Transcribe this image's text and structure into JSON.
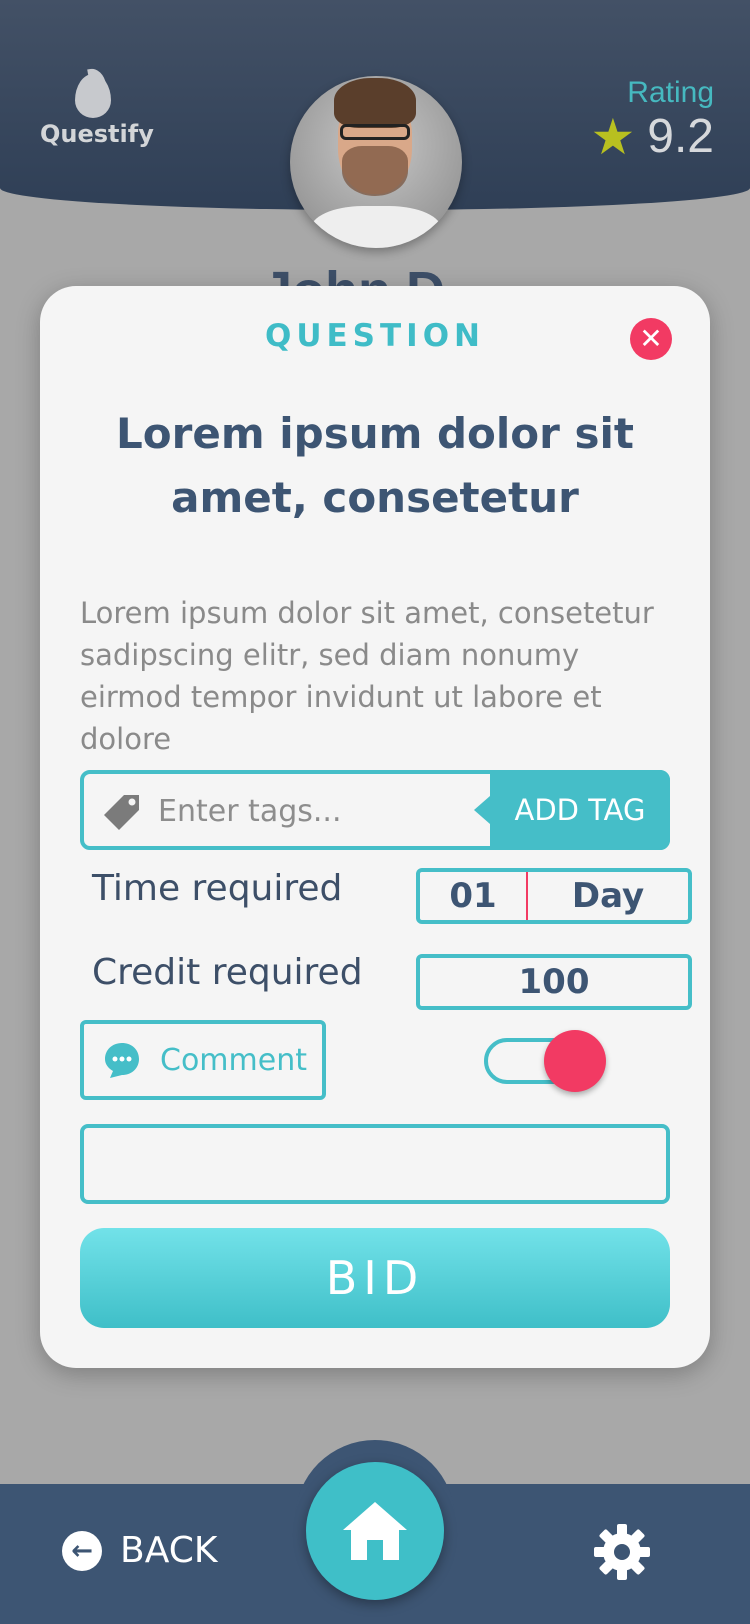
{
  "app": {
    "logo_text": "Questify"
  },
  "header": {
    "rating_label": "Rating",
    "rating_value": "9.2",
    "user_name_partial": "John D"
  },
  "card": {
    "label": "QUESTION",
    "title": "Lorem ipsum dolor sit amet, consetetur",
    "body": "Lorem ipsum dolor sit amet, consetetur sadipscing elitr, sed diam nonumy eirmod tempor invidunt ut labore et dolore",
    "tags": {
      "placeholder": "Enter tags...",
      "add_label": "ADD TAG"
    },
    "time": {
      "label": "Time required",
      "value": "01",
      "unit": "Day"
    },
    "credit": {
      "label": "Credit required",
      "value": "100"
    },
    "comment": {
      "label": "Comment",
      "toggle_on": true
    },
    "bid_label": "BID"
  },
  "nav": {
    "back_label": "BACK"
  },
  "colors": {
    "accent": "#45bec8",
    "danger": "#f23a63",
    "primary": "#3d5573",
    "star": "#b8c020"
  },
  "icons": [
    "flame-logo-icon",
    "star-icon",
    "close-icon",
    "tag-icon",
    "comment-icon",
    "arrow-left-icon",
    "home-icon",
    "gear-icon"
  ]
}
